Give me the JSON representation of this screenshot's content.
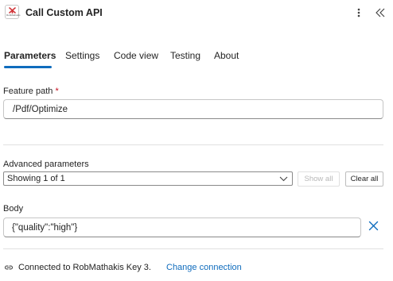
{
  "header": {
    "app_icon_text": "RobMathakis",
    "title": "Call Custom API",
    "icons": {
      "more": "more-vertical-icon",
      "collapse": "double-chevron-left-icon"
    }
  },
  "tabs": [
    {
      "label": "Parameters",
      "active": true
    },
    {
      "label": "Settings",
      "active": false
    },
    {
      "label": "Code view",
      "active": false
    },
    {
      "label": "Testing",
      "active": false
    },
    {
      "label": "About",
      "active": false
    }
  ],
  "feature_path": {
    "label": "Feature path",
    "required_marker": "*",
    "value": "/Pdf/Optimize"
  },
  "advanced": {
    "label": "Advanced parameters",
    "selected": "Showing 1 of 1",
    "show_all_label": "Show all",
    "clear_all_label": "Clear all"
  },
  "body_param": {
    "label": "Body",
    "value": "{\"quality\":\"high\"}"
  },
  "footer": {
    "connected_text": "Connected to RobMathakis Key 3.",
    "change_connection_label": "Change connection"
  },
  "colors": {
    "accent": "#0f6cbd",
    "required": "#c50f1f",
    "divider": "#e0e0e0"
  }
}
